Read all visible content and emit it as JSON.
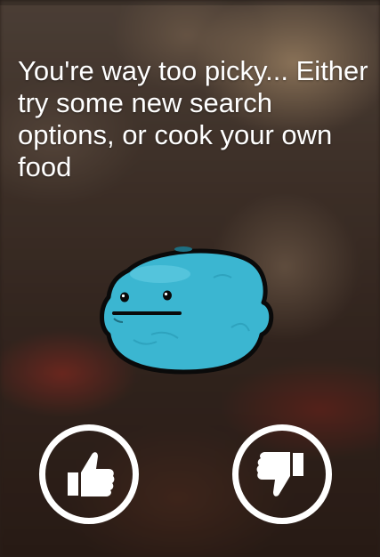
{
  "app": {
    "message": "You're way too picky... Either try some new search options, or cook your own food"
  },
  "mascot": {
    "icon": "blue-blob-mascot-icon",
    "color": "#3bb6d1"
  },
  "actions": {
    "like": {
      "icon": "thumbs-up-icon"
    },
    "dislike": {
      "icon": "thumbs-down-icon"
    }
  },
  "colors": {
    "text": "#ffffff",
    "button_outline": "#ffffff"
  }
}
